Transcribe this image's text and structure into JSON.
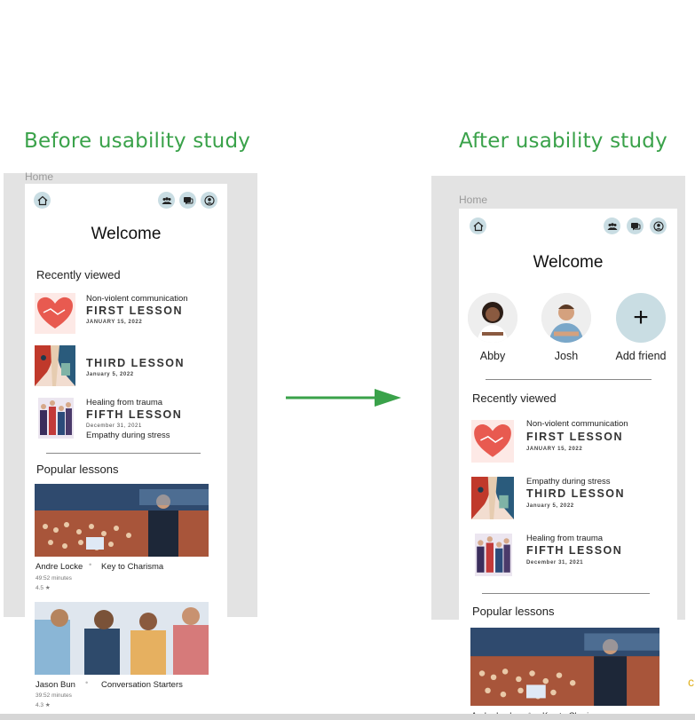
{
  "headings": {
    "before": "Before usability study",
    "after": "After usability study"
  },
  "panel_label": "Home",
  "colors": {
    "heading": "#3aa24a",
    "arrow": "#3aa24a",
    "icon_bg": "#c9dde3"
  },
  "nav_icons": [
    "home-icon",
    "friends-icon",
    "chat-icon",
    "profile-icon"
  ],
  "before": {
    "welcome": "Welcome",
    "recently_viewed": "Recently viewed",
    "lessons": [
      {
        "subtitle": "Non-violent communication",
        "title": "FIRST LESSON",
        "date": "JANUARY 15, 2022",
        "extra": ""
      },
      {
        "subtitle": "",
        "title": "THIRD LESSON",
        "date": "January 5, 2022",
        "extra": ""
      },
      {
        "subtitle": "Healing from trauma",
        "title": "FIFTH LESSON",
        "date": "December 31, 2021",
        "extra": "Empathy during stress"
      }
    ],
    "popular_lessons": "Popular lessons",
    "popular": [
      {
        "author": "Andre Locke",
        "title": "Key to Charisma",
        "duration": "49:52 minutes",
        "rating": "4.5 ★"
      },
      {
        "author": "Jason Bun",
        "title": "Conversation Starters",
        "duration": "39:52 minutes",
        "rating": "4.3 ★"
      }
    ]
  },
  "after": {
    "welcome": "Welcome",
    "friends": [
      {
        "name": "Abby"
      },
      {
        "name": "Josh"
      },
      {
        "name": "Add friend",
        "symbol": "+"
      }
    ],
    "recently_viewed": "Recently viewed",
    "lessons": [
      {
        "subtitle": "Non-violent communication",
        "title": "FIRST LESSON",
        "date": "JANUARY 15, 2022"
      },
      {
        "subtitle": "Empathy during stress",
        "title": "THIRD LESSON",
        "date": "January 5, 2022"
      },
      {
        "subtitle": "Healing from trauma",
        "title": "FIFTH LESSON",
        "date": "December 31, 2021"
      }
    ],
    "popular_lessons": "Popular lessons",
    "popular": [
      {
        "author": "Andre Locke",
        "title": "Key to Charisma"
      }
    ]
  }
}
